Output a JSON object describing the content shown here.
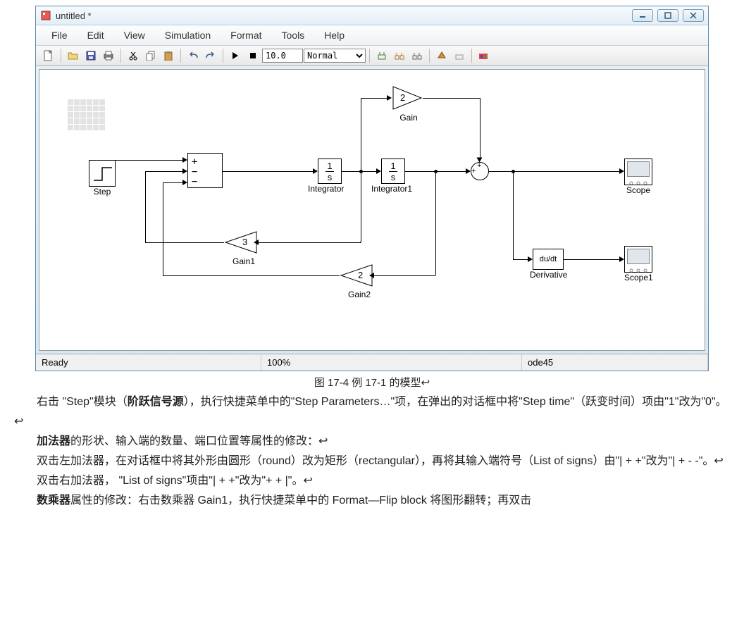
{
  "window": {
    "title": "untitled *"
  },
  "menu": {
    "file": "File",
    "edit": "Edit",
    "view": "View",
    "simulation": "Simulation",
    "format": "Format",
    "tools": "Tools",
    "help": "Help"
  },
  "toolbar": {
    "stop_time": "10.0",
    "mode": "Normal"
  },
  "blocks": {
    "step": "Step",
    "gain": "Gain",
    "gain_val": "2",
    "gain1": "Gain1",
    "gain1_val": "3",
    "gain2": "Gain2",
    "gain2_val": "2",
    "integrator": "Integrator",
    "integrator1": "Integrator1",
    "derivative": "Derivative",
    "deriv_text": "du/dt",
    "scope": "Scope",
    "scope1": "Scope1",
    "int_num": "1",
    "int_den": "s",
    "sum_circle_signs": "++"
  },
  "statusbar": {
    "ready": "Ready",
    "zoom": "100%",
    "solver": "ode45"
  },
  "doc": {
    "caption": "图 17-4   例 17-1 的模型↩",
    "p1a": "右击 \"Step\"模块（",
    "p1b": "阶跃信号源",
    "p1c": "），执行快捷菜单中的\"Step Parameters…\"项，在弹出的对话框中将\"Step time\"（跃变时间）项由\"1\"改为\"0\"。↩",
    "p2a": "加法器",
    "p2b": "的形状、输入端的数量、端口位置等属性的修改：↩",
    "p3": "双击左加法器，在对话框中将其外形由圆形（round）改为矩形（rectangular），再将其输入端符号（List of signs）由\"| + +\"改为\"| + - -\"。↩",
    "p4": "双击右加法器， \"List of signs\"项由\"| + +\"改为\"+ + |\"。↩",
    "p5a": "数乘器",
    "p5b": "属性的修改：右击数乘器 Gain1，执行快捷菜单中的 Format—Flip block 将图形翻转；再双击"
  }
}
